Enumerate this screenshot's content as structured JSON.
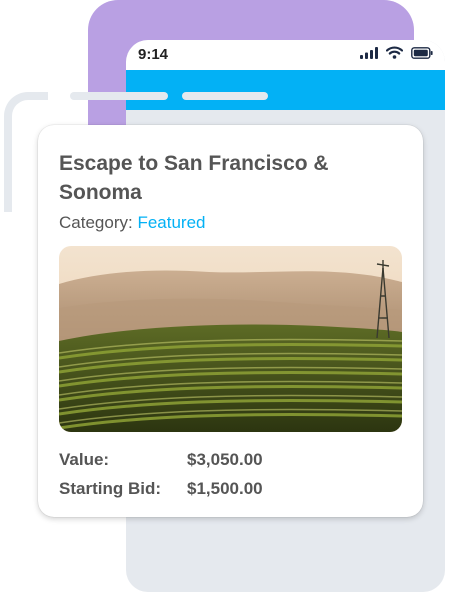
{
  "status_bar": {
    "time": "9:14",
    "icons": [
      "signal-icon",
      "wifi-icon",
      "battery-icon"
    ]
  },
  "listing": {
    "title": "Escape to San Francisco & Sonoma",
    "category_label": "Category:",
    "category_value": "Featured",
    "image": "vineyard-photo",
    "value_label": "Value:",
    "value_amount": "$3,050.00",
    "bid_label": "Starting Bid:",
    "bid_amount": "$1,500.00"
  },
  "colors": {
    "accent_blue": "#03b1f5",
    "purple": "#b9a0e3",
    "phone_grey": "#e5e9ee",
    "text": "#555555"
  }
}
